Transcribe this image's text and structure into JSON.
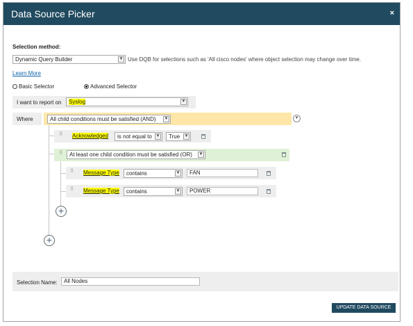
{
  "dialog": {
    "title": "Data Source Picker",
    "close_glyph": "×"
  },
  "selection_method": {
    "label": "Selection method:",
    "dropdown_value": "Dynamic Query Builder",
    "hint": "Use DQB for selections such as 'All cisco nodes' where object selection may change over time.",
    "learn_more": "Learn More",
    "basic_label": "Basic Selector",
    "advanced_label": "Advanced Selector",
    "selected": "advanced"
  },
  "report_on": {
    "label": "I want to report on",
    "value": "Syslog"
  },
  "where": {
    "label": "Where",
    "root_condition": "All child conditions must be satisfied (AND)",
    "acknowledged": {
      "field": "Acknowledged",
      "operator": "is not equal to",
      "value": "True"
    },
    "or_group": {
      "condition": "At least one child condition must be satisfied (OR)",
      "rows": [
        {
          "field": "Message Type",
          "operator": "contains",
          "value": "FAN"
        },
        {
          "field": "Message Type",
          "operator": "contains",
          "value": "POWER"
        }
      ]
    },
    "add_glyph": "+"
  },
  "footer": {
    "selection_name_label": "Selection Name:",
    "selection_name_value": "All Nodes",
    "update_button": "UPDATE DATA SOURCE"
  },
  "colors": {
    "titlebar": "#204a5f",
    "highlight": "#ffff00",
    "and_group": "#fde6a8",
    "or_group": "#dff1d6",
    "row_bg": "#eeeeee"
  },
  "icons": [
    "close-icon",
    "dropdown-caret-icon",
    "drag-grip-icon",
    "trash-icon",
    "add-icon",
    "collapse-icon"
  ]
}
